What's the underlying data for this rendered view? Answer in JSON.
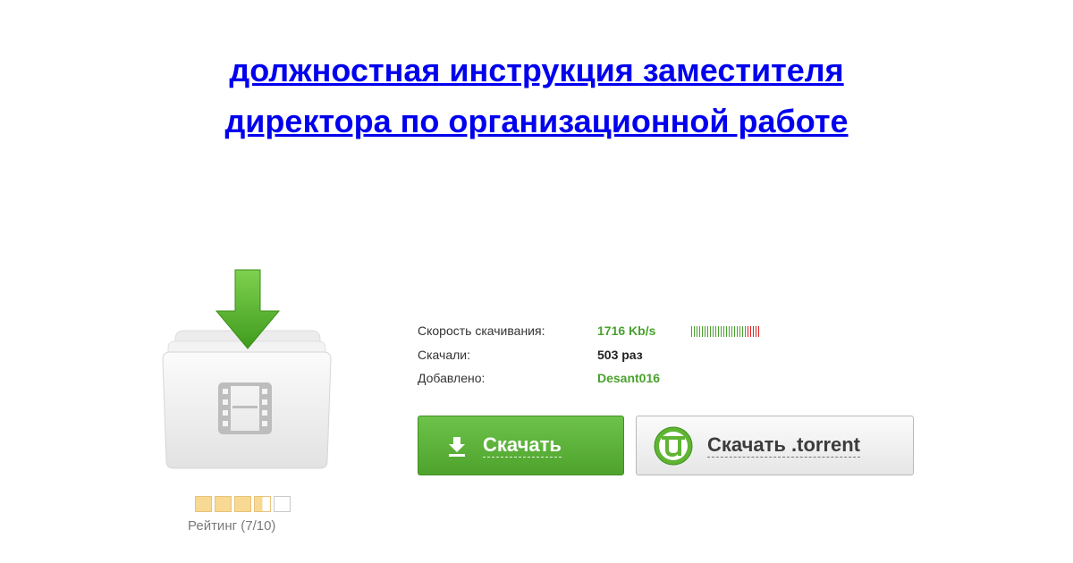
{
  "title": {
    "line1": "должностная инструкция заместителя",
    "line2": "директора по организационной работе"
  },
  "icon": {
    "main": "folder-video-download-icon"
  },
  "info": {
    "speed_label": "Скорость скачивания:",
    "speed_value": "1716 Kb/s",
    "downloads_label": "Скачали:",
    "downloads_value": "503 раз",
    "added_label": "Добавлено:",
    "added_value": "Desant016"
  },
  "speed_bar": {
    "green_ticks": 21,
    "red_ticks": 5,
    "green": "#4aa12e",
    "red": "#e12020"
  },
  "buttons": {
    "download_label": "Скачать",
    "torrent_label": "Скачать .torrent"
  },
  "rating": {
    "label": "Рейтинг (7/10)",
    "value": 7,
    "max": 10,
    "boxes": 5
  },
  "colors": {
    "link": "#0000ee",
    "accent_green": "#4ea32c"
  }
}
